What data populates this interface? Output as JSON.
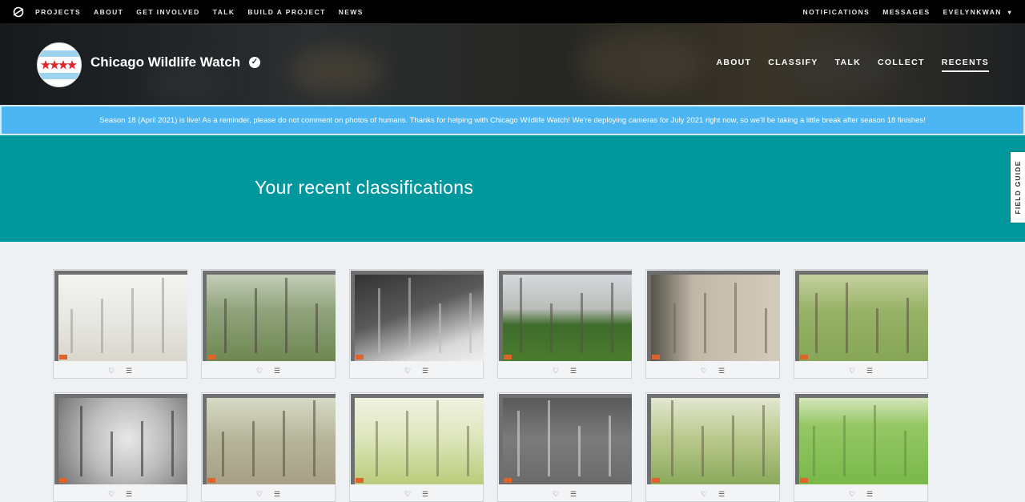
{
  "topnav": {
    "logo_icon": "zooniverse-logo-icon",
    "links": [
      "PROJECTS",
      "ABOUT",
      "GET INVOLVED",
      "TALK",
      "BUILD A PROJECT",
      "NEWS"
    ],
    "right": {
      "notifications": "NOTIFICATIONS",
      "messages": "MESSAGES",
      "user": "EVELYNKWAN"
    }
  },
  "project": {
    "title": "Chicago Wildlife Watch",
    "nav": [
      "ABOUT",
      "CLASSIFY",
      "TALK",
      "COLLECT",
      "RECENTS"
    ],
    "active_nav": "RECENTS"
  },
  "banner": {
    "text": "Season 18 (April 2021) is live! As a reminder, please do not comment on photos of humans. Thanks for helping with Chicago Wildlife Watch! We're deploying cameras for July 2021 right now, so we'll be taking a little break after season 18 finishes!"
  },
  "hero": {
    "title": "Your recent classifications"
  },
  "field_guide": {
    "label": "FIELD GUIDE"
  },
  "colors": {
    "teal": "#00979d",
    "banner": "#4db6f2",
    "topbar": "#000000"
  },
  "classifications": [
    {
      "scene": "foggy-forest"
    },
    {
      "scene": "green-woods"
    },
    {
      "scene": "night-branches"
    },
    {
      "scene": "train-yard"
    },
    {
      "scene": "leaf-litter"
    },
    {
      "scene": "grassy-clearing"
    },
    {
      "scene": "night-animal-closeup"
    },
    {
      "scene": "woods-log"
    },
    {
      "scene": "sunny-woods"
    },
    {
      "scene": "night-brush"
    },
    {
      "scene": "bright-shrubs"
    },
    {
      "scene": "green-lawn"
    }
  ]
}
